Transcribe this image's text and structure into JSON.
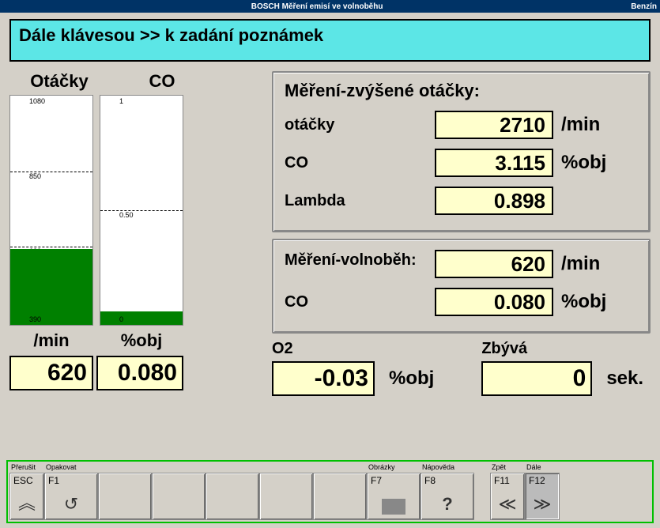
{
  "titlebar": {
    "center": "BOSCH Měření emisí ve volnoběhu",
    "right": "Benzín"
  },
  "banner": "Dále klávesou >> k zadání poznámek",
  "gauges": {
    "rpm": {
      "header": "Otáčky",
      "unit": "/min",
      "top": "1080",
      "mid": "850",
      "fill_label_top": "620",
      "bottom": "390",
      "value": "620",
      "fill_pct": 33
    },
    "co": {
      "header": "CO",
      "unit": "%obj",
      "top": "1",
      "mid": "0.50",
      "bottom": "0",
      "value": "0.080",
      "fill_pct": 6
    }
  },
  "panel_high": {
    "title": "Měření-zvýšené otáčky:",
    "rows": [
      {
        "label": "otáčky",
        "value": "2710",
        "unit": "/min"
      },
      {
        "label": "CO",
        "value": "3.115",
        "unit": "%obj"
      },
      {
        "label": "Lambda",
        "value": "0.898",
        "unit": ""
      }
    ]
  },
  "panel_idle": {
    "title": "Měření-volnoběh:",
    "rows": [
      {
        "label": "",
        "value": "620",
        "unit": "/min"
      },
      {
        "label": "CO",
        "value": "0.080",
        "unit": "%obj"
      }
    ]
  },
  "bottom": {
    "o2": {
      "label": "O2",
      "value": "-0.03",
      "unit": "%obj"
    },
    "remain": {
      "label": "Zbývá",
      "value": "0",
      "unit": "sek."
    }
  },
  "fkeys": {
    "labels": {
      "esc": "Přerušit",
      "f1": "Opakovat",
      "f7": "Obrázky",
      "f8": "Nápověda",
      "f11": "Zpět",
      "f12": "Dále"
    },
    "keys": {
      "esc": "ESC",
      "f1": "F1",
      "f7": "F7",
      "f8": "F8",
      "f11": "F11",
      "f12": "F12"
    }
  },
  "chart_data": [
    {
      "type": "bar",
      "title": "Otáčky",
      "ylabel": "/min",
      "ylim": [
        390,
        1080
      ],
      "ticks": [
        390,
        620,
        850,
        1080
      ],
      "values": [
        620
      ]
    },
    {
      "type": "bar",
      "title": "CO",
      "ylabel": "%obj",
      "ylim": [
        0,
        1
      ],
      "ticks": [
        0,
        0.5,
        1
      ],
      "values": [
        0.08
      ]
    }
  ]
}
